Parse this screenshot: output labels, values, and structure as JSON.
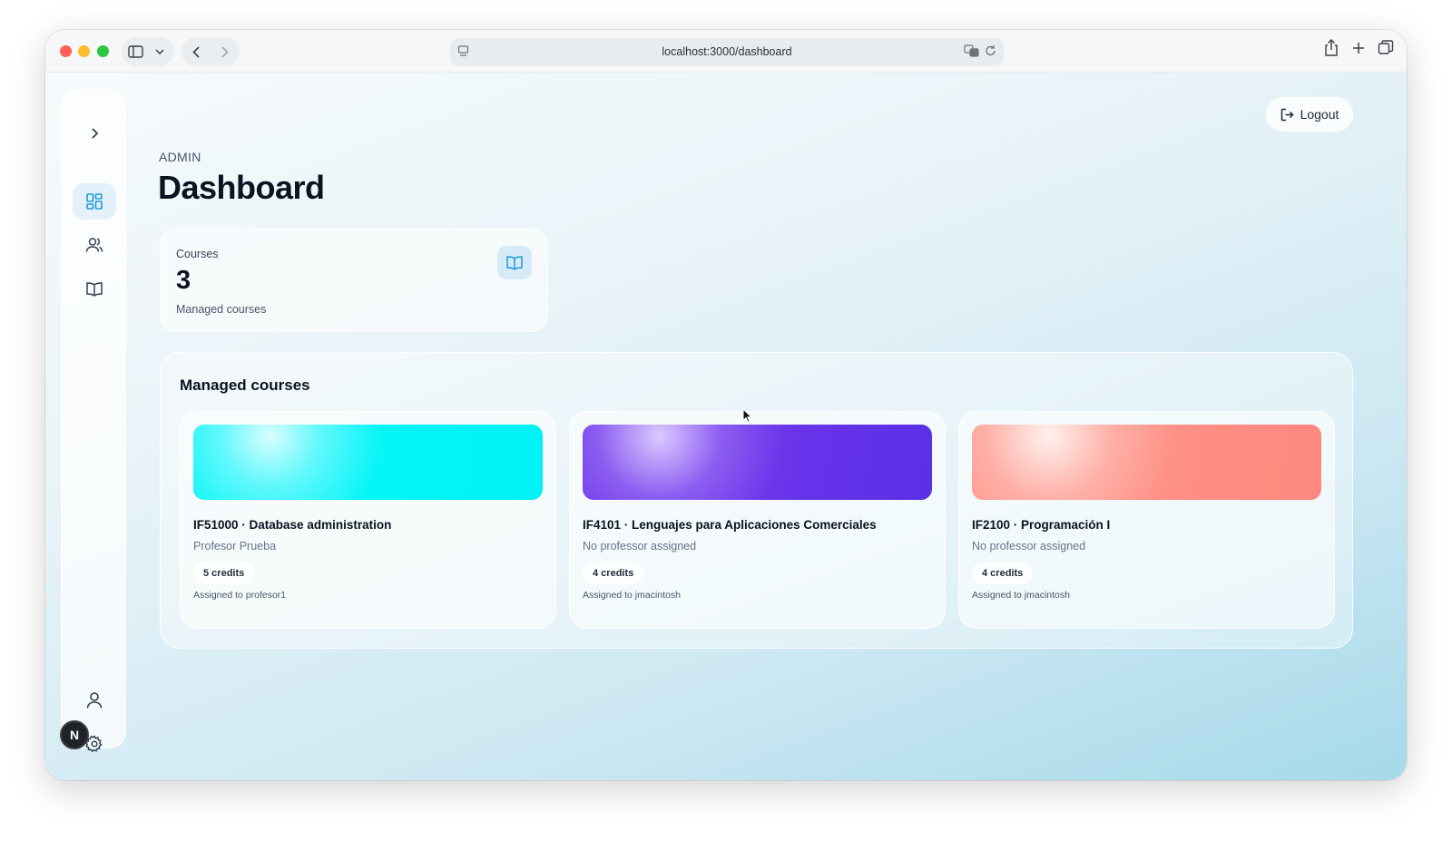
{
  "browser": {
    "url": "localhost:3000/dashboard"
  },
  "header": {
    "logout_label": "Logout"
  },
  "page": {
    "eyebrow": "ADMIN",
    "title": "Dashboard"
  },
  "sidebar": {
    "items": [
      {
        "name": "toggle",
        "icon": "chevron-right-icon"
      },
      {
        "name": "dashboard",
        "icon": "dashboard-icon",
        "active": true
      },
      {
        "name": "users",
        "icon": "users-icon"
      },
      {
        "name": "courses",
        "icon": "book-open-icon"
      },
      {
        "name": "profile",
        "icon": "user-icon"
      },
      {
        "name": "settings",
        "icon": "gear-icon"
      }
    ],
    "badge": "N"
  },
  "stats": {
    "label": "Courses",
    "value": "3",
    "sublabel": "Managed courses"
  },
  "courses_panel": {
    "title": "Managed courses",
    "courses": [
      {
        "title": "IF51000 · Database administration",
        "professor": "Profesor Prueba",
        "credits": "5 credits",
        "assigned": "Assigned to profesor1",
        "color": "#00f2f5"
      },
      {
        "title": "IF4101 · Lenguajes para Aplicaciones Comerciales",
        "professor": "No professor assigned",
        "credits": "4 credits",
        "assigned": "Assigned to jmacintosh",
        "color": "#5a2fe8"
      },
      {
        "title": "IF2100 · Programación I",
        "professor": "No professor assigned",
        "credits": "4 credits",
        "assigned": "Assigned to jmacintosh",
        "color": "#fd877e"
      }
    ]
  },
  "colors": {
    "accent": "#1d9bd8"
  }
}
